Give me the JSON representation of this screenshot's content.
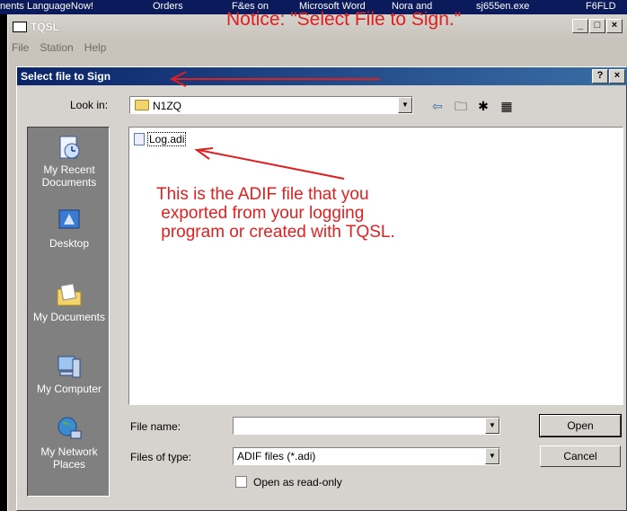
{
  "taskbar": {
    "items": [
      "nents  LanguageNow!",
      "Orders",
      "F&es on",
      "Microsoft Word",
      "Nora and",
      "sj655en.exe",
      "F6FLD"
    ]
  },
  "tqsl": {
    "title": "TQSL",
    "menu": [
      "File",
      "Station",
      "Help"
    ]
  },
  "notice": "Notice: \"Select File to Sign.\"",
  "dialog": {
    "title": "Select file to Sign",
    "look_in_label": "Look in:",
    "look_in_value": "N1ZQ",
    "places": [
      {
        "label": "My Recent\nDocuments",
        "icon": "recent-documents-icon"
      },
      {
        "label": "Desktop",
        "icon": "desktop-icon"
      },
      {
        "label": "My Documents",
        "icon": "my-documents-icon"
      },
      {
        "label": "My Computer",
        "icon": "my-computer-icon"
      },
      {
        "label": "My Network\nPlaces",
        "icon": "network-places-icon"
      }
    ],
    "files": [
      {
        "name": "Log.adi"
      }
    ],
    "file_name_label": "File name:",
    "file_name_value": "",
    "files_of_type_label": "Files of type:",
    "files_of_type_value": "ADIF files (*.adi)",
    "open_readonly_label": "Open as read-only",
    "open_button": "Open",
    "cancel_button": "Cancel"
  },
  "annotation": "This is the ADIF file that you\n exported from your logging\n program or created with TQSL.",
  "colors": {
    "annotation": "#e02020",
    "title_bar": "#0a246a"
  }
}
